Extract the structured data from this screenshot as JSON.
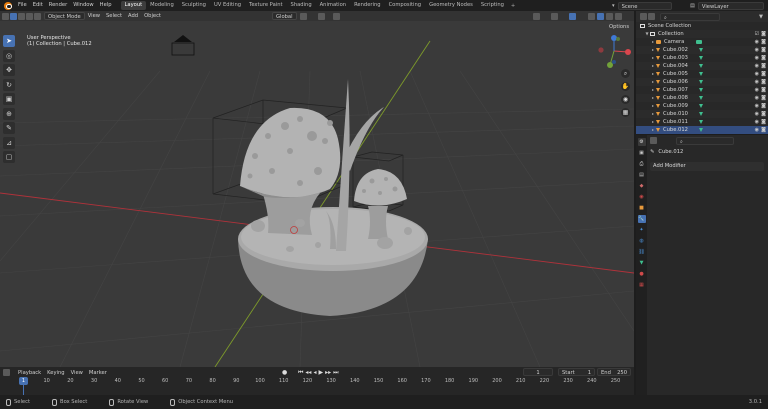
{
  "menu": {
    "file": "File",
    "edit": "Edit",
    "render": "Render",
    "window": "Window",
    "help": "Help"
  },
  "workspaces": [
    {
      "label": "Layout",
      "active": true
    },
    {
      "label": "Modeling"
    },
    {
      "label": "Sculpting"
    },
    {
      "label": "UV Editing"
    },
    {
      "label": "Texture Paint"
    },
    {
      "label": "Shading"
    },
    {
      "label": "Animation"
    },
    {
      "label": "Rendering"
    },
    {
      "label": "Compositing"
    },
    {
      "label": "Geometry Nodes"
    },
    {
      "label": "Scripting"
    }
  ],
  "scene": "Scene",
  "view_layer": "ViewLayer",
  "viewport": {
    "mode": "Object Mode",
    "menu": [
      "View",
      "Select",
      "Add",
      "Object"
    ],
    "orientation": "Global",
    "options": "Options",
    "perspective": "User Perspective",
    "collection_info": "(1) Collection | Cube.012"
  },
  "outliner": {
    "scene_collection": "Scene Collection",
    "collection": "Collection",
    "items": [
      "Camera",
      "Cube.002",
      "Cube.003",
      "Cube.004",
      "Cube.005",
      "Cube.006",
      "Cube.007",
      "Cube.008",
      "Cube.009",
      "Cube.010",
      "Cube.011",
      "Cube.012"
    ],
    "selected": "Cube.012"
  },
  "properties": {
    "object_name": "Cube.012",
    "add_modifier": "Add Modifier"
  },
  "timeline": {
    "menu": [
      "Playback",
      "Keying",
      "View",
      "Marker"
    ],
    "current_frame": "1",
    "start_label": "Start",
    "start": "1",
    "end_label": "End",
    "end": "250",
    "ticks": [
      "0",
      "10",
      "20",
      "30",
      "40",
      "50",
      "60",
      "70",
      "80",
      "90",
      "100",
      "110",
      "120",
      "130",
      "140",
      "150",
      "160",
      "170",
      "180",
      "190",
      "200",
      "210",
      "220",
      "230",
      "240",
      "250"
    ]
  },
  "status": {
    "select": "Select",
    "box_select": "Box Select",
    "rotate_view": "Rotate View",
    "context_menu": "Object Context Menu",
    "version": "3.0.1"
  },
  "colors": {
    "accent": "#4772b3",
    "viewport_bg": "#3a3a3a",
    "x_axis": "#b0323a",
    "y_axis": "#7d9a2a"
  }
}
